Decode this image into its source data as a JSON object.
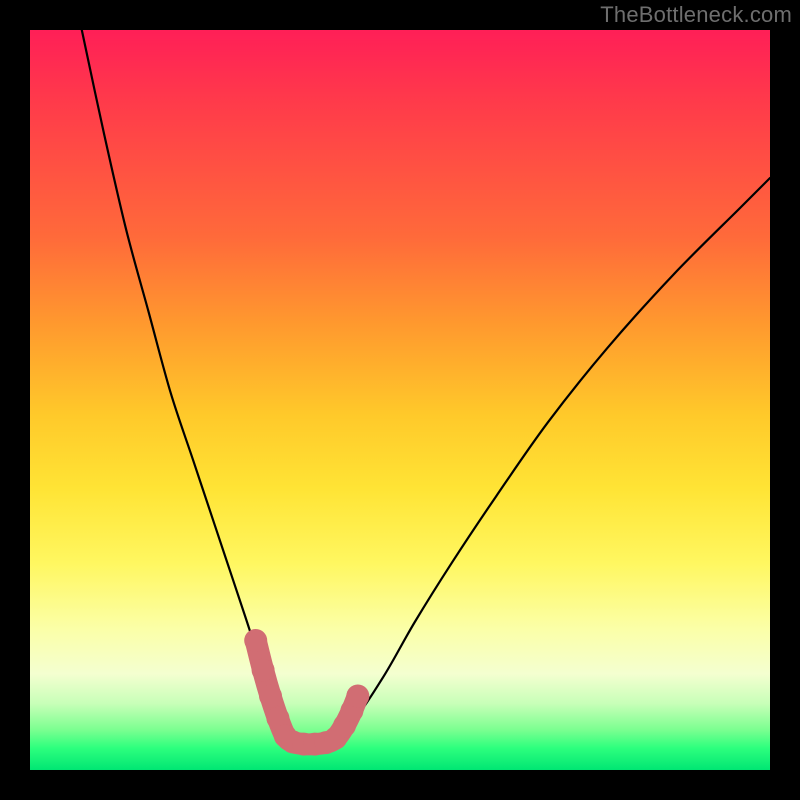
{
  "attribution": "TheBottleneck.com",
  "chart_data": {
    "type": "line",
    "title": "",
    "xlabel": "",
    "ylabel": "",
    "xlim": [
      0,
      100
    ],
    "ylim": [
      0,
      100
    ],
    "grid": false,
    "legend": false,
    "series": [
      {
        "name": "bottleneck-curve",
        "color": "#000000",
        "x": [
          7,
          10,
          13,
          16,
          19,
          22,
          25,
          27,
          29,
          31,
          33,
          34.5,
          36,
          38,
          40,
          44,
          48,
          52,
          57,
          63,
          70,
          78,
          87,
          96,
          100
        ],
        "y": [
          100,
          86,
          73,
          62,
          51,
          42,
          33,
          27,
          21,
          15,
          10,
          6.5,
          3,
          3,
          3,
          7,
          13,
          20,
          28,
          37,
          47,
          57,
          67,
          76,
          80
        ]
      }
    ],
    "annotations": [
      {
        "name": "valley-highlight",
        "color": "#d16d73",
        "points_xy": [
          [
            30.5,
            17.5
          ],
          [
            31.5,
            13.5
          ],
          [
            32.5,
            10.0
          ],
          [
            33.5,
            7.0
          ],
          [
            34.5,
            4.6
          ],
          [
            35.5,
            3.8
          ],
          [
            37.0,
            3.5
          ],
          [
            38.5,
            3.5
          ],
          [
            40.0,
            3.7
          ],
          [
            41.3,
            4.3
          ],
          [
            42.5,
            6.0
          ],
          [
            43.5,
            8.0
          ],
          [
            44.3,
            10.0
          ]
        ]
      }
    ]
  }
}
